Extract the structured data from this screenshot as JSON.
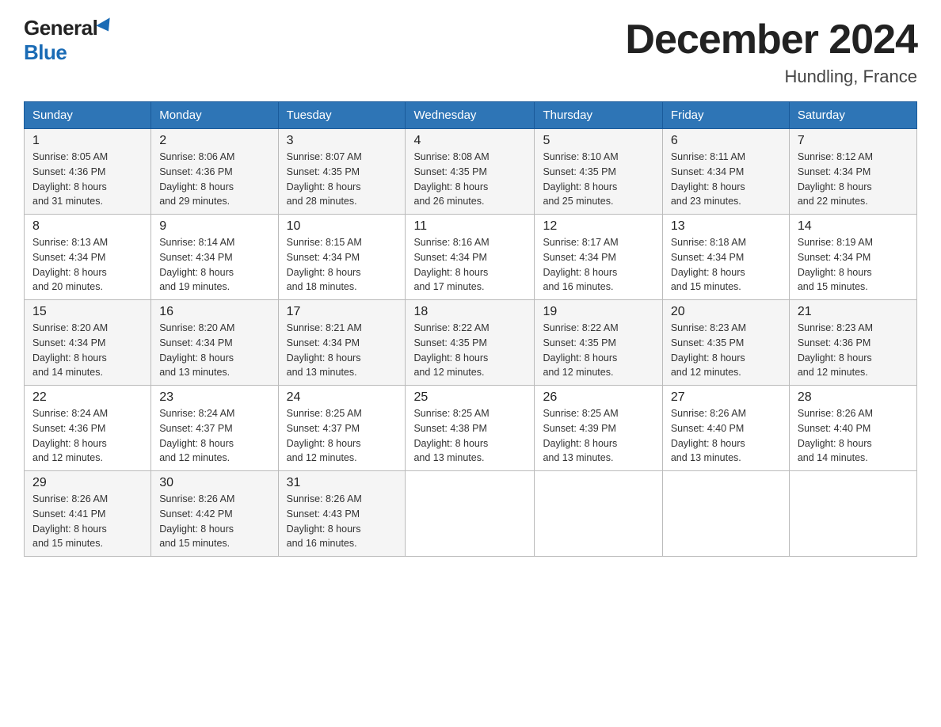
{
  "logo": {
    "general": "General",
    "blue": "Blue"
  },
  "title": {
    "month_year": "December 2024",
    "location": "Hundling, France"
  },
  "weekdays": [
    "Sunday",
    "Monday",
    "Tuesday",
    "Wednesday",
    "Thursday",
    "Friday",
    "Saturday"
  ],
  "weeks": [
    [
      {
        "day": "1",
        "sunrise": "8:05 AM",
        "sunset": "4:36 PM",
        "daylight": "8 hours and 31 minutes."
      },
      {
        "day": "2",
        "sunrise": "8:06 AM",
        "sunset": "4:36 PM",
        "daylight": "8 hours and 29 minutes."
      },
      {
        "day": "3",
        "sunrise": "8:07 AM",
        "sunset": "4:35 PM",
        "daylight": "8 hours and 28 minutes."
      },
      {
        "day": "4",
        "sunrise": "8:08 AM",
        "sunset": "4:35 PM",
        "daylight": "8 hours and 26 minutes."
      },
      {
        "day": "5",
        "sunrise": "8:10 AM",
        "sunset": "4:35 PM",
        "daylight": "8 hours and 25 minutes."
      },
      {
        "day": "6",
        "sunrise": "8:11 AM",
        "sunset": "4:34 PM",
        "daylight": "8 hours and 23 minutes."
      },
      {
        "day": "7",
        "sunrise": "8:12 AM",
        "sunset": "4:34 PM",
        "daylight": "8 hours and 22 minutes."
      }
    ],
    [
      {
        "day": "8",
        "sunrise": "8:13 AM",
        "sunset": "4:34 PM",
        "daylight": "8 hours and 20 minutes."
      },
      {
        "day": "9",
        "sunrise": "8:14 AM",
        "sunset": "4:34 PM",
        "daylight": "8 hours and 19 minutes."
      },
      {
        "day": "10",
        "sunrise": "8:15 AM",
        "sunset": "4:34 PM",
        "daylight": "8 hours and 18 minutes."
      },
      {
        "day": "11",
        "sunrise": "8:16 AM",
        "sunset": "4:34 PM",
        "daylight": "8 hours and 17 minutes."
      },
      {
        "day": "12",
        "sunrise": "8:17 AM",
        "sunset": "4:34 PM",
        "daylight": "8 hours and 16 minutes."
      },
      {
        "day": "13",
        "sunrise": "8:18 AM",
        "sunset": "4:34 PM",
        "daylight": "8 hours and 15 minutes."
      },
      {
        "day": "14",
        "sunrise": "8:19 AM",
        "sunset": "4:34 PM",
        "daylight": "8 hours and 15 minutes."
      }
    ],
    [
      {
        "day": "15",
        "sunrise": "8:20 AM",
        "sunset": "4:34 PM",
        "daylight": "8 hours and 14 minutes."
      },
      {
        "day": "16",
        "sunrise": "8:20 AM",
        "sunset": "4:34 PM",
        "daylight": "8 hours and 13 minutes."
      },
      {
        "day": "17",
        "sunrise": "8:21 AM",
        "sunset": "4:34 PM",
        "daylight": "8 hours and 13 minutes."
      },
      {
        "day": "18",
        "sunrise": "8:22 AM",
        "sunset": "4:35 PM",
        "daylight": "8 hours and 12 minutes."
      },
      {
        "day": "19",
        "sunrise": "8:22 AM",
        "sunset": "4:35 PM",
        "daylight": "8 hours and 12 minutes."
      },
      {
        "day": "20",
        "sunrise": "8:23 AM",
        "sunset": "4:35 PM",
        "daylight": "8 hours and 12 minutes."
      },
      {
        "day": "21",
        "sunrise": "8:23 AM",
        "sunset": "4:36 PM",
        "daylight": "8 hours and 12 minutes."
      }
    ],
    [
      {
        "day": "22",
        "sunrise": "8:24 AM",
        "sunset": "4:36 PM",
        "daylight": "8 hours and 12 minutes."
      },
      {
        "day": "23",
        "sunrise": "8:24 AM",
        "sunset": "4:37 PM",
        "daylight": "8 hours and 12 minutes."
      },
      {
        "day": "24",
        "sunrise": "8:25 AM",
        "sunset": "4:37 PM",
        "daylight": "8 hours and 12 minutes."
      },
      {
        "day": "25",
        "sunrise": "8:25 AM",
        "sunset": "4:38 PM",
        "daylight": "8 hours and 13 minutes."
      },
      {
        "day": "26",
        "sunrise": "8:25 AM",
        "sunset": "4:39 PM",
        "daylight": "8 hours and 13 minutes."
      },
      {
        "day": "27",
        "sunrise": "8:26 AM",
        "sunset": "4:40 PM",
        "daylight": "8 hours and 13 minutes."
      },
      {
        "day": "28",
        "sunrise": "8:26 AM",
        "sunset": "4:40 PM",
        "daylight": "8 hours and 14 minutes."
      }
    ],
    [
      {
        "day": "29",
        "sunrise": "8:26 AM",
        "sunset": "4:41 PM",
        "daylight": "8 hours and 15 minutes."
      },
      {
        "day": "30",
        "sunrise": "8:26 AM",
        "sunset": "4:42 PM",
        "daylight": "8 hours and 15 minutes."
      },
      {
        "day": "31",
        "sunrise": "8:26 AM",
        "sunset": "4:43 PM",
        "daylight": "8 hours and 16 minutes."
      },
      null,
      null,
      null,
      null
    ]
  ],
  "labels": {
    "sunrise": "Sunrise:",
    "sunset": "Sunset:",
    "daylight": "Daylight:"
  }
}
